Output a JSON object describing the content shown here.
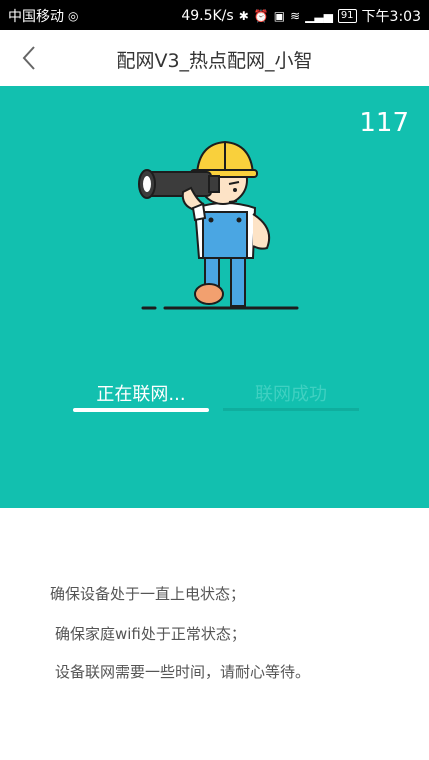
{
  "statusbar": {
    "carrier": "中国移动",
    "speed": "49.5K/s",
    "battery": "91",
    "time": "下午3:03"
  },
  "header": {
    "title": "配网V3_热点配网_小智",
    "back_icon": "chevron-left-icon"
  },
  "hero": {
    "countdown": "117",
    "illustration": "worker-telescope-illustration",
    "steps": [
      {
        "label": "正在联网...",
        "active": true
      },
      {
        "label": "联网成功",
        "active": false
      }
    ],
    "colors": {
      "background": "#12c0af",
      "inactive_text": "#3fd0c1"
    }
  },
  "tips": [
    "确保设备处于一直上电状态；",
    "确保家庭wifi处于正常状态；",
    "设备联网需要一些时间，请耐心等待。"
  ]
}
